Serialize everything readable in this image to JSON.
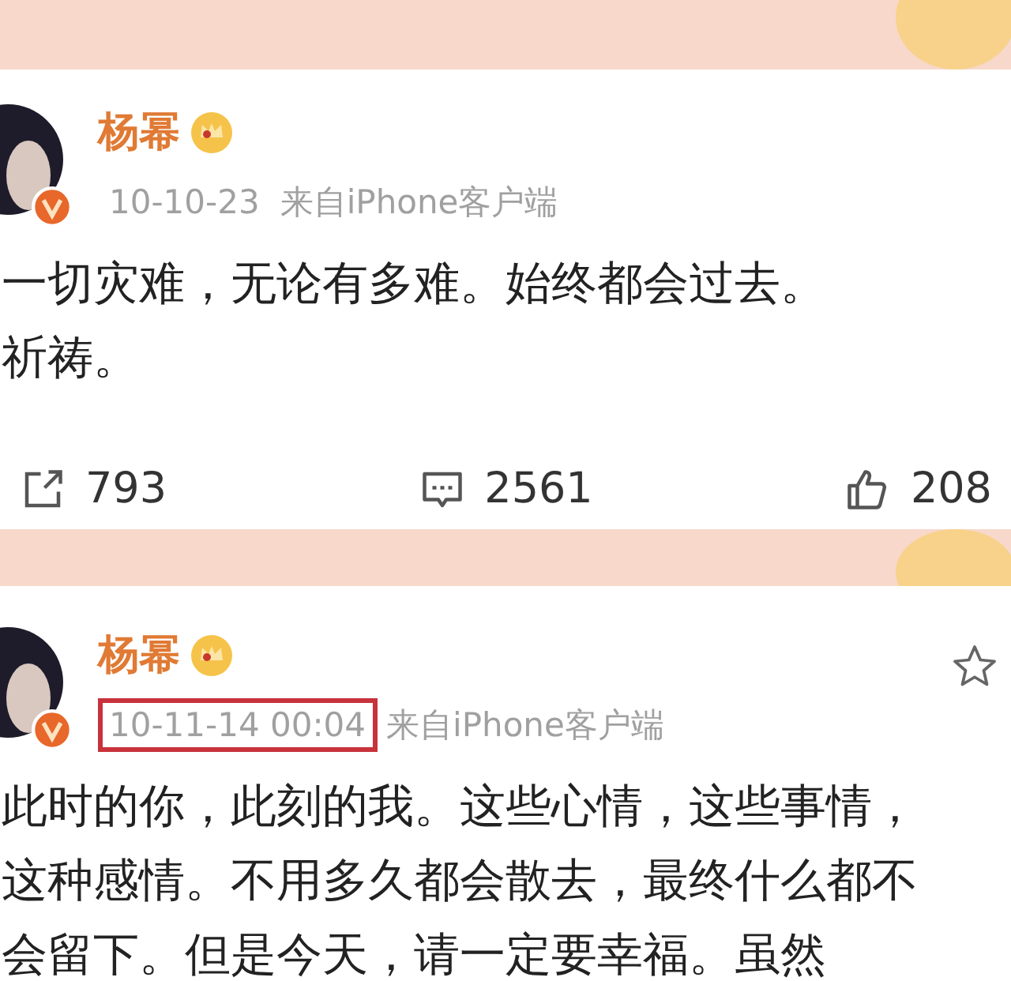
{
  "posts": [
    {
      "author": "杨幂",
      "date": "10-10-23",
      "source": "来自iPhone客户端",
      "date_highlighted": false,
      "show_star": false,
      "lines": [
        "一切灾难，无论有多难。始终都会过去。",
        "祈祷。"
      ],
      "stats": [
        {
          "kind": "share",
          "count": "793"
        },
        {
          "kind": "comment",
          "count": "2561"
        },
        {
          "kind": "like",
          "count": "208"
        }
      ]
    },
    {
      "author": "杨幂",
      "date": "10-11-14 00:04",
      "source": "来自iPhone客户端",
      "date_highlighted": true,
      "show_star": true,
      "lines": [
        "此时的你，此刻的我。这些心情，这些事情，",
        "这种感情。不用多久都会散去，最终什么都不",
        "会留下。但是今天，请一定要幸福。虽然"
      ]
    }
  ]
}
